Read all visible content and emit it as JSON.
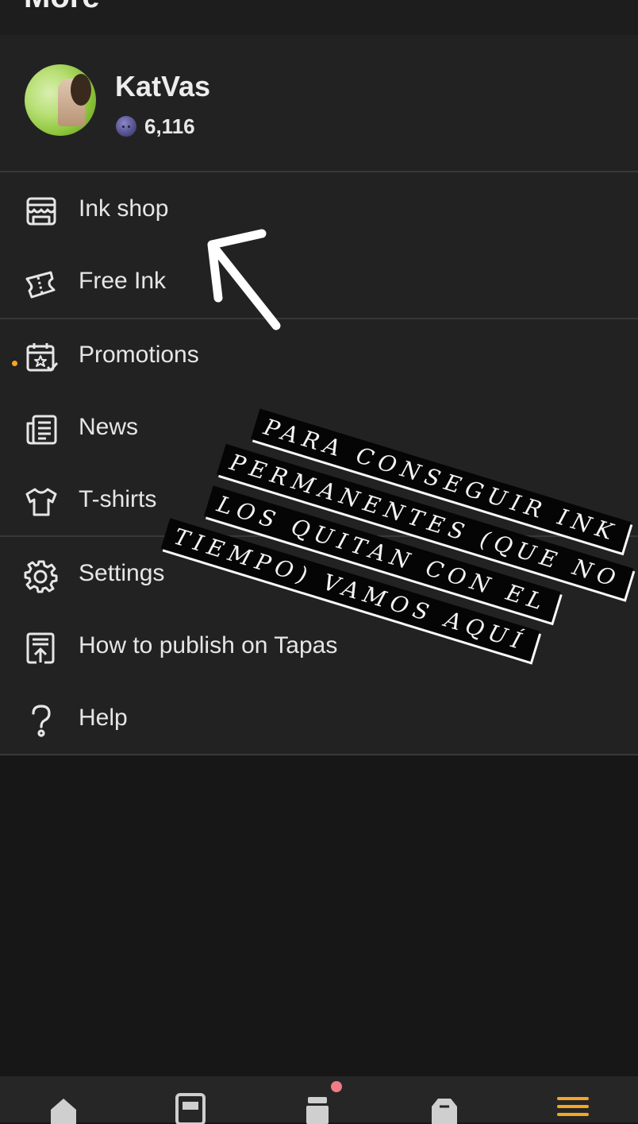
{
  "header": {
    "title": "More"
  },
  "profile": {
    "username": "KatVas",
    "ink_count": "6,116"
  },
  "menu": {
    "ink_shop": "Ink shop",
    "free_ink": "Free Ink",
    "promotions": "Promotions",
    "news": "News",
    "tshirts": "T-shirts",
    "settings": "Settings",
    "how_to_publish": "How to publish on Tapas",
    "help": "Help"
  },
  "annotation": {
    "line1": "PARA CONSEGUIR INK",
    "line2": "PERMANENTES (QUE NO",
    "line3": "LOS QUITAN CON EL",
    "line4": "TIEMPO) VAMOS AQUÍ"
  },
  "tabbar": {
    "tabs": [
      "home-icon",
      "library-icon",
      "inbox-icon",
      "shop-icon",
      "menu-icon"
    ],
    "active_index": 4,
    "accent_color": "#f5a623"
  },
  "colors": {
    "background": "#181818",
    "panel": "#222222",
    "accent": "#f5a623",
    "notification": "#f07b88"
  }
}
